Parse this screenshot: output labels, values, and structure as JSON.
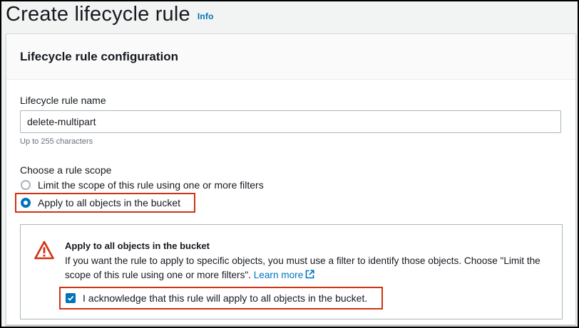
{
  "page": {
    "title": "Create lifecycle rule",
    "info_link": "Info"
  },
  "panel": {
    "header": "Lifecycle rule configuration",
    "rule_name": {
      "label": "Lifecycle rule name",
      "value": "delete-multipart",
      "constraint": "Up to 255 characters"
    },
    "scope": {
      "label": "Choose a rule scope",
      "options": [
        {
          "label": "Limit the scope of this rule using one or more filters",
          "selected": false
        },
        {
          "label": "Apply to all objects in the bucket",
          "selected": true
        }
      ]
    },
    "alert": {
      "icon": "warning-icon",
      "title": "Apply to all objects in the bucket",
      "body": "If you want the rule to apply to specific objects, you must use a filter to identify those objects. Choose \"Limit the scope of this rule using one or more filters\".",
      "link": "Learn more",
      "link_icon": "external-link-icon",
      "acknowledge": {
        "label": "I acknowledge that this rule will apply to all objects in the bucket.",
        "checked": true
      }
    }
  },
  "colors": {
    "accent": "#0073bb",
    "highlight": "#d13212",
    "warning": "#d13212",
    "text": "#16191f",
    "muted": "#687078"
  }
}
